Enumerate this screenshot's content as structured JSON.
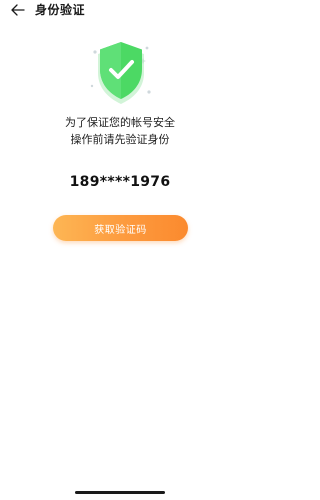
{
  "header": {
    "back_icon": "arrow-left-icon",
    "title": "身份验证"
  },
  "hero": {
    "icon": "shield-check-icon",
    "accent_color": "#4cd964"
  },
  "message": {
    "line1": "为了保证您的帐号安全",
    "line2": "操作前请先验证身份"
  },
  "phone": {
    "masked_number": "189****1976"
  },
  "actions": {
    "get_code_label": "获取验证码",
    "button_color": "#fd9a3e"
  }
}
